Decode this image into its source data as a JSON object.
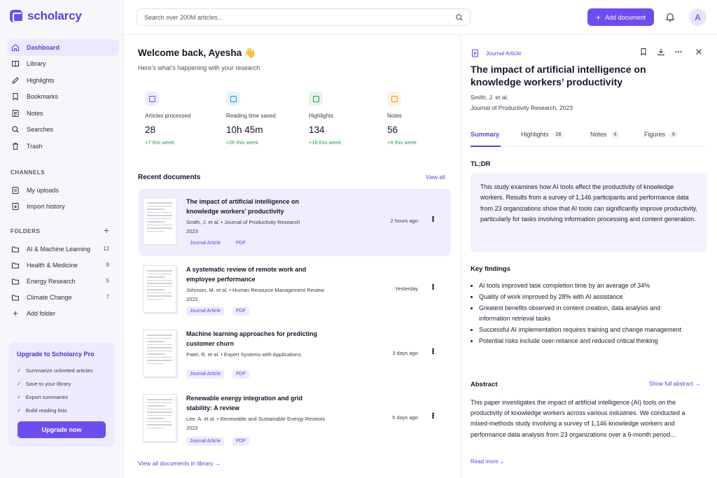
{
  "brand": {
    "name": "scholarcy"
  },
  "nav": [
    {
      "label": "Dashboard",
      "icon": "home-icon",
      "active": true
    },
    {
      "label": "Library",
      "icon": "book-icon"
    },
    {
      "label": "Highlights",
      "icon": "pen-icon"
    },
    {
      "label": "Bookmarks",
      "icon": "bookmark-icon"
    },
    {
      "label": "Notes",
      "icon": "notes-icon"
    },
    {
      "label": "Searches",
      "icon": "search-icon"
    },
    {
      "label": "Trash",
      "icon": "trash-icon"
    }
  ],
  "channels": {
    "label": "CHANNELS",
    "items": [
      {
        "label": "My uploads",
        "icon": "upload-icon"
      },
      {
        "label": "Import history",
        "icon": "import-icon"
      }
    ]
  },
  "folders": {
    "label": "FOLDERS",
    "items": [
      {
        "label": "AI & Machine Learning",
        "count": "12"
      },
      {
        "label": "Health & Medicine",
        "count": "8"
      },
      {
        "label": "Energy Research",
        "count": "5"
      },
      {
        "label": "Climate Change",
        "count": "7"
      }
    ],
    "add_label": "Add folder"
  },
  "upgrade": {
    "title": "Upgrade to Scholarcy Pro",
    "features": [
      "Summarize unlimited articles",
      "Save to your library",
      "Export summaries",
      "Build reading lists"
    ],
    "button": "Upgrade now"
  },
  "topbar": {
    "search_placeholder": "Search over 200M articles...",
    "add_document": "Add document",
    "avatar_initial": "A"
  },
  "main": {
    "welcome": "Welcome back, Ayesha 👋",
    "subtitle": "Here’s what’s happening with your research",
    "stats": [
      {
        "label": "Articles processed",
        "value": "28",
        "delta": "+7 this week",
        "color": "#6d4df2",
        "bg": "#eeebff"
      },
      {
        "label": "Reading time saved",
        "value": "10h 45m",
        "delta": "+2h this week",
        "color": "#1a8fc9",
        "bg": "#e3f4fc"
      },
      {
        "label": "Highlights",
        "value": "134",
        "delta": "+18 this week",
        "color": "#1f9d55",
        "bg": "#e4f6ea"
      },
      {
        "label": "Notes",
        "value": "56",
        "delta": "+9 this week",
        "color": "#d99a06",
        "bg": "#fdf4dc"
      }
    ],
    "recent_title": "Recent documents",
    "view_all": "View all",
    "documents": [
      {
        "title": "The impact of artificial intelligence on knowledge workers’ productivity",
        "meta": "Smith, J. et al.  •  Journal of Productivity Research",
        "year": "2023",
        "time": "2 hours ago",
        "tag1": "Journal Article",
        "tag2": "PDF"
      },
      {
        "title": "A systematic review of remote work and employee performance",
        "meta": "Johnson, M. et al.  •  Human Resource Management Review",
        "year": "2022",
        "time": "Yesterday",
        "tag1": "Journal Article",
        "tag2": "PDF"
      },
      {
        "title": "Machine learning approaches for predicting customer churn",
        "meta": "Patel, R. et al.  •  Expert Systems with Applications",
        "year": "2023",
        "time": "3 days ago",
        "tag1": "Journal Article",
        "tag2": "PDF"
      },
      {
        "title": "Renewable energy integration and grid stability: A review",
        "meta": "Lee, A. et al.  •  Renewable and Sustainable Energy Reviews",
        "year": "2022",
        "time": "5 days ago",
        "tag1": "Journal Article",
        "tag2": "PDF"
      }
    ],
    "view_all_docs": "View all documents in library →"
  },
  "panel": {
    "type": "Journal Article",
    "title": "The impact of artificial intelligence on knowledge workers’ productivity",
    "authors": "Smith, J. et al.",
    "journal": "Journal of Productivity Research, 2023",
    "tabs": [
      {
        "label": "Summary",
        "count": ""
      },
      {
        "label": "Highlights",
        "count": "28"
      },
      {
        "label": "Notes",
        "count": "4"
      },
      {
        "label": "Figures",
        "count": "6"
      }
    ],
    "tldr_heading": "TL;DR",
    "tldr": "This study examines how AI tools affect the productivity of knowledge workers. Results from a survey of 1,146 participants and performance data from 23 organizations show that AI tools can significantly improve productivity, particularly for tasks involving information processing and content generation.",
    "findings_heading": "Key findings",
    "findings": [
      "AI tools improved task completion time by an average of 34%",
      "Quality of work improved by 28% with AI assistance",
      "Greatest benefits observed in content creation, data analysis and information retrieval tasks",
      "Successful AI implementation requires training and change management",
      "Potential risks include over-reliance and reduced critical thinking"
    ],
    "abstract_heading": "Abstract",
    "show_full_abstract": "Show full abstract →",
    "abstract": "This paper investigates the impact of artificial intelligence (AI) tools on the productivity of knowledge workers across various industries. We conducted a mixed-methods study involving a survey of 1,146 knowledge workers and performance data analysis from 23 organizations over a 6-month period...",
    "read_more": "Read more ⌄"
  }
}
